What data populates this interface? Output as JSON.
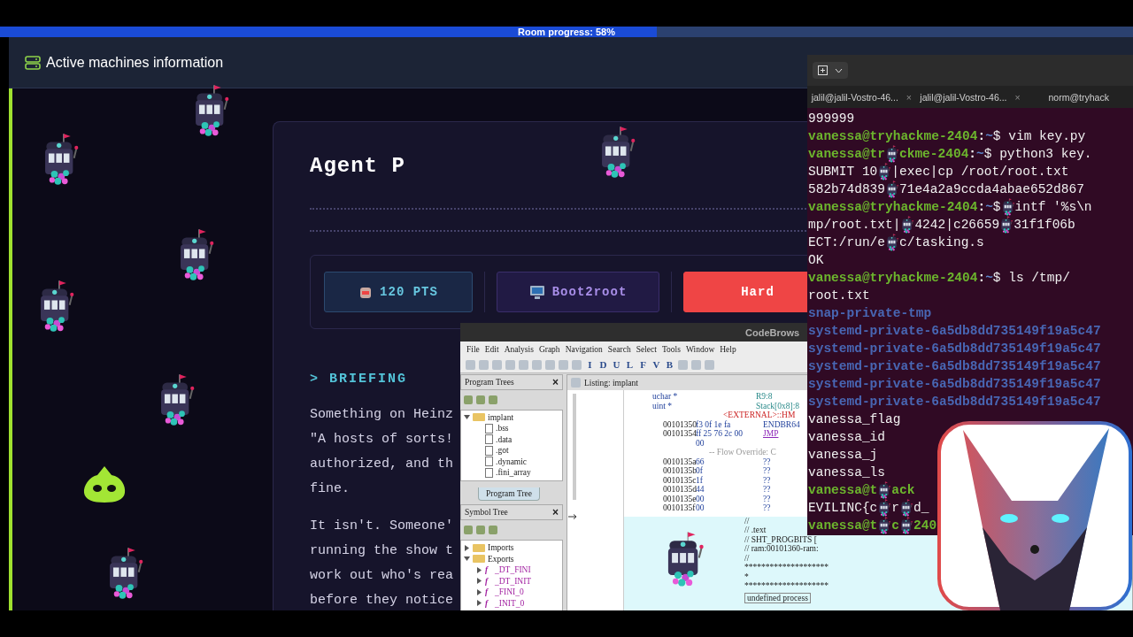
{
  "progress": {
    "label": "Room progress: 58%",
    "level": 0.58
  },
  "header": {
    "title": "Active machines information"
  },
  "room": {
    "title": "Agent P",
    "stats": [
      {
        "kind": "points",
        "label": "120 PTS"
      },
      {
        "kind": "category",
        "label": "Boot2root"
      },
      {
        "kind": "difficulty",
        "label": "Hard"
      }
    ],
    "briefing": {
      "heading": "> BRIEFING",
      "paragraphs": [
        [
          "Something on Heinz",
          "\"A hosts of sorts!",
          "authorized, and th",
          "fine."
        ],
        [
          "It isn't. Someone'",
          "running the show t",
          "work out who's rea",
          "before they notice"
        ]
      ]
    }
  },
  "code_browser": {
    "title": "CodeBrows",
    "menu": [
      "File",
      "Edit",
      "Analysis",
      "Graph",
      "Navigation",
      "Search",
      "Select",
      "Tools",
      "Window",
      "Help"
    ],
    "toolbar_letters": [
      "I",
      "D",
      "U",
      "L",
      "F",
      "V",
      "B"
    ],
    "program_trees": {
      "title": "Program Trees",
      "close": "×",
      "tab": "Program Tree",
      "tree": [
        {
          "label": "implant",
          "expanded": true,
          "children": [
            {
              "label": ".bss"
            },
            {
              "label": ".data"
            },
            {
              "label": ".got"
            },
            {
              "label": ".dynamic"
            },
            {
              "label": ".fini_array"
            }
          ]
        }
      ]
    },
    "symbol_tree": {
      "title": "Symbol Tree",
      "close": "×",
      "tree": [
        {
          "label": "Imports",
          "expanded": false
        },
        {
          "label": "Exports",
          "expanded": true,
          "children": [
            {
              "icon": "f",
              "label": "_DT_FINI",
              "expanded": false
            },
            {
              "icon": "f",
              "label": "_DT_INIT",
              "expanded": false
            },
            {
              "icon": "f",
              "label": "_FINI_0",
              "expanded": false
            },
            {
              "icon": "f",
              "label": "_INIT_0",
              "expanded": false
            }
          ]
        }
      ]
    },
    "listing": {
      "title": "Listing: implant",
      "rows": [
        {
          "kind": "param",
          "type": "uchar *",
          "storage": "R9:8"
        },
        {
          "kind": "param",
          "type": "uint *",
          "storage": "Stack[0x8]:8"
        },
        {
          "kind": "external",
          "text": "<EXTERNAL>::HM"
        },
        {
          "kind": "instr",
          "address": "00101350",
          "bytes": "f3 0f 1e fa",
          "mnemonic": "ENDBR64",
          "link": false
        },
        {
          "kind": "instr",
          "address": "00101354",
          "bytes": "ff 25 76 2c 00",
          "mnemonic": "JMP",
          "link": true
        },
        {
          "kind": "cont",
          "bytes": "00"
        },
        {
          "kind": "note",
          "text": "-- Flow Override: C"
        },
        {
          "kind": "instr",
          "address": "0010135a",
          "bytes": "66",
          "mnemonic": "??",
          "link": false
        },
        {
          "kind": "instr",
          "address": "0010135b",
          "bytes": "0f",
          "mnemonic": "??",
          "link": false
        },
        {
          "kind": "instr",
          "address": "0010135c",
          "bytes": "1f",
          "mnemonic": "??",
          "link": false
        },
        {
          "kind": "instr",
          "address": "0010135d",
          "bytes": "44",
          "mnemonic": "??",
          "link": false
        },
        {
          "kind": "instr",
          "address": "0010135e",
          "bytes": "00",
          "mnemonic": "??",
          "link": false
        },
        {
          "kind": "instr",
          "address": "0010135f",
          "bytes": "00",
          "mnemonic": "??",
          "link": false
        },
        {
          "kind": "section",
          "comments": [
            "//",
            "// .text",
            "// SHT_PROGBITS [",
            "// ram:00101360-ram:",
            "//",
            "********************",
            "*",
            "********************"
          ],
          "footer": "undefined process"
        }
      ]
    }
  },
  "terminal": {
    "tabs": [
      {
        "label": "jalil@jalil-Vostro-46...",
        "close": "×"
      },
      {
        "label": "jalil@jalil-Vostro-46...",
        "close": "×"
      },
      {
        "label": "norm@tryhack"
      }
    ],
    "lines": [
      [
        {
          "kind": "out",
          "text": "999999"
        }
      ],
      [
        {
          "kind": "user",
          "text": "vanessa@tryhackme-2404"
        },
        {
          "kind": "sep",
          "text": ":"
        },
        {
          "kind": "path",
          "text": "~"
        },
        {
          "kind": "out",
          "text": "$ vim key.py"
        }
      ],
      [
        {
          "kind": "user",
          "text": "vanessa@tr"
        },
        {
          "kind": "machine"
        },
        {
          "kind": "user",
          "text": "ckme-2404"
        },
        {
          "kind": "sep",
          "text": ":"
        },
        {
          "kind": "path",
          "text": "~"
        },
        {
          "kind": "out",
          "text": "$ python3 key."
        }
      ],
      [
        {
          "kind": "out",
          "text": "SUBMIT 10"
        },
        {
          "kind": "machine"
        },
        {
          "kind": "out",
          "text": "|exec|cp /root/root.txt"
        }
      ],
      [
        {
          "kind": "out",
          "text": "582b74d839"
        },
        {
          "kind": "machine"
        },
        {
          "kind": "out",
          "text": "71e4a2a9ccda4abae652d867"
        }
      ],
      [
        {
          "kind": "user",
          "text": "vanessa@tryhackme-2404"
        },
        {
          "kind": "sep",
          "text": ":"
        },
        {
          "kind": "path",
          "text": "~"
        },
        {
          "kind": "out",
          "text": "$"
        },
        {
          "kind": "machine"
        },
        {
          "kind": "out",
          "text": "intf '%s\\n"
        }
      ],
      [
        {
          "kind": "out",
          "text": "mp/root.txt|"
        },
        {
          "kind": "machine"
        },
        {
          "kind": "out",
          "text": "4242|c26659"
        },
        {
          "kind": "machine"
        },
        {
          "kind": "out",
          "text": "31f1f06b"
        }
      ],
      [
        {
          "kind": "out",
          "text": "ECT:/run/e"
        },
        {
          "kind": "machine"
        },
        {
          "kind": "out",
          "text": "c/tasking.s"
        }
      ],
      [
        {
          "kind": "out",
          "text": "OK"
        }
      ],
      [
        {
          "kind": "user",
          "text": "vanessa@tryhackme-2404"
        },
        {
          "kind": "sep",
          "text": ":"
        },
        {
          "kind": "path",
          "text": "~"
        },
        {
          "kind": "out",
          "text": "$ ls /tmp/"
        }
      ],
      [
        {
          "kind": "out",
          "text": "root.txt"
        }
      ],
      [
        {
          "kind": "dir",
          "text": "snap-private-tmp"
        }
      ],
      [
        {
          "kind": "dir",
          "text": "systemd-private-6a5db8dd735149f19a5c47"
        }
      ],
      [
        {
          "kind": "dir",
          "text": "systemd-private-6a5db8dd735149f19a5c47"
        }
      ],
      [
        {
          "kind": "dir",
          "text": "systemd-private-6a5db8dd735149f19a5c47"
        }
      ],
      [
        {
          "kind": "dir",
          "text": "systemd-private-6a5db8dd735149f19a5c47"
        }
      ],
      [
        {
          "kind": "dir",
          "text": "systemd-private-6a5db8dd735149f19a5c47"
        }
      ],
      [
        {
          "kind": "out",
          "text": "vanessa_flag"
        }
      ],
      [
        {
          "kind": "out",
          "text": "vanessa_id"
        }
      ],
      [
        {
          "kind": "out",
          "text": "vanessa_j"
        }
      ],
      [
        {
          "kind": "out",
          "text": "vanessa_ls"
        }
      ],
      [
        {
          "kind": "user",
          "text": "vanessa@t"
        },
        {
          "kind": "machine"
        },
        {
          "kind": "user",
          "text": "ack"
        }
      ],
      [
        {
          "kind": "out",
          "text": "EVILINC{c"
        },
        {
          "kind": "machine"
        },
        {
          "kind": "out",
          "text": "r"
        },
        {
          "kind": "machine"
        },
        {
          "kind": "out",
          "text": "d_"
        }
      ],
      [
        {
          "kind": "user",
          "text": "vanessa@t"
        },
        {
          "kind": "machine"
        },
        {
          "kind": "user",
          "text": "c"
        },
        {
          "kind": "machine"
        },
        {
          "kind": "user",
          "text": "240"
        }
      ]
    ]
  }
}
